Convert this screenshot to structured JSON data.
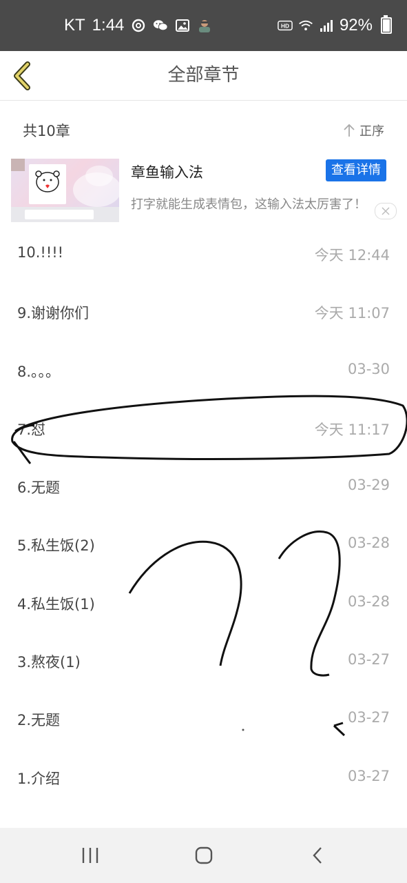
{
  "status_bar": {
    "carrier": "KT",
    "time": "1:44",
    "notification_icons": [
      "netease-music-icon",
      "wechat-icon",
      "gallery-icon",
      "avatar-icon"
    ],
    "system_icons": [
      "hd-icon",
      "wifi-icon",
      "signal-icon"
    ],
    "battery_percent": "92%",
    "battery_level": 0.92
  },
  "header": {
    "title": "全部章节",
    "back_icon": "chevron-left-icon",
    "accent_color": "#d4c24a"
  },
  "summary": {
    "count_label": "共10章",
    "sort_label": "正序",
    "sort_icon": "arrow-up-icon"
  },
  "ad": {
    "title": "章鱼输入法",
    "button_label": "查看详情",
    "description": "打字就能生成表情包，这输入法太厉害了！",
    "close_icon": "close-icon",
    "button_color": "#1a73e8"
  },
  "chapters": [
    {
      "title": "10.!!!!",
      "date": "今天 12:44"
    },
    {
      "title": "9.谢谢你们",
      "date": "今天 11:07"
    },
    {
      "title": "8.。。。",
      "date": "03-30"
    },
    {
      "title": "7.怼",
      "date": "今天 11:17"
    },
    {
      "title": "6.无题",
      "date": "03-29"
    },
    {
      "title": "5.私生饭(2)",
      "date": "03-28"
    },
    {
      "title": "4.私生饭(1)",
      "date": "03-28"
    },
    {
      "title": "3.熬夜(1)",
      "date": "03-27"
    },
    {
      "title": "2.无题",
      "date": "03-27"
    },
    {
      "title": "1.介绍",
      "date": "03-27"
    }
  ],
  "nav_bar": {
    "buttons": [
      "recents-icon",
      "home-icon",
      "back-icon"
    ]
  }
}
